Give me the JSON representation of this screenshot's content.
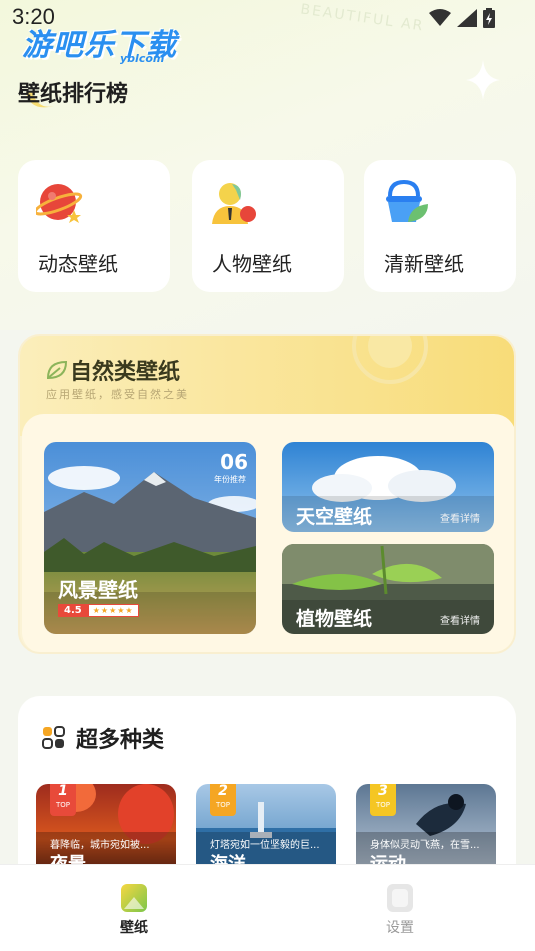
{
  "status": {
    "time": "3:20"
  },
  "watermark": {
    "text": "游吧乐下载",
    "sub": "yblcom"
  },
  "decor": {
    "text": "BEAUTIFUL AR"
  },
  "header": {
    "title": "壁纸排行榜"
  },
  "categories": [
    {
      "label": "动态壁纸",
      "icon": "planet-icon"
    },
    {
      "label": "人物壁纸",
      "icon": "person-icon"
    },
    {
      "label": "清新壁纸",
      "icon": "bucket-icon"
    }
  ],
  "nature": {
    "title": "自然类壁纸",
    "subtitle": "应用壁纸，感受自然之美",
    "landscape": {
      "label": "风景壁纸",
      "rating": "4.5",
      "date": "06",
      "date_caption": "年份推荐",
      "stars": 4.5
    },
    "sky": {
      "label": "天空壁纸",
      "detail": "查看详情"
    },
    "plant": {
      "label": "植物壁纸",
      "detail": "查看详情"
    }
  },
  "more": {
    "title": "超多种类",
    "items": [
      {
        "rank": "1",
        "top": "TOP",
        "desc": "暮降临，城市宛如被...",
        "name": "夜景"
      },
      {
        "rank": "2",
        "top": "TOP",
        "desc": "灯塔宛如一位坚毅的巨...",
        "name": "海洋"
      },
      {
        "rank": "3",
        "top": "TOP",
        "desc": "身体似灵动飞燕，在雪...",
        "name": "运动"
      }
    ]
  },
  "nav": {
    "items": [
      {
        "label": "壁纸",
        "active": true
      },
      {
        "label": "设置",
        "active": false
      }
    ]
  },
  "colors": {
    "accent_red": "#e84a3a",
    "badge_orange": "#f5a623",
    "active_nav": "#222222",
    "inactive_nav": "#9a9a9a"
  }
}
